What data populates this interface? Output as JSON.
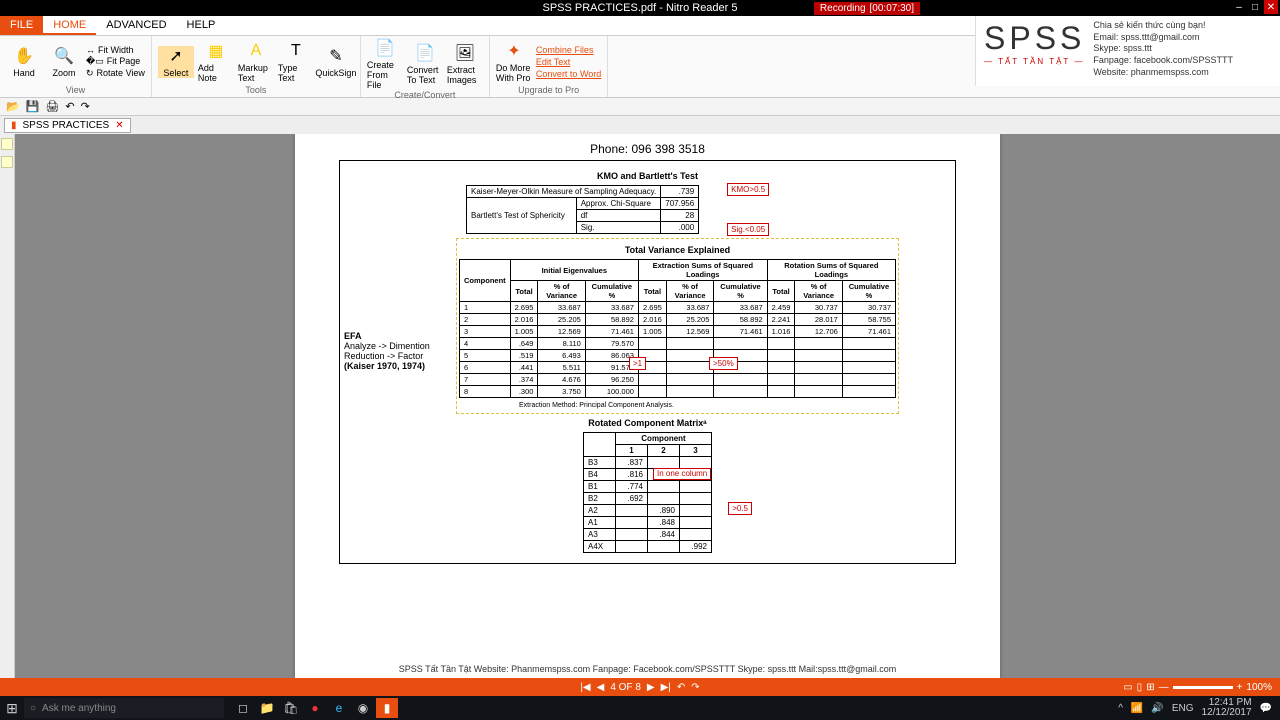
{
  "app": {
    "title": "SPSS PRACTICES.pdf - Nitro Reader 5"
  },
  "recording": {
    "label": "Recording",
    "time": "[00:07:30]"
  },
  "logo": {
    "main": "SPSS",
    "sub": "— TẤT TẦN TẬT —",
    "share": "Chia sẻ kiến thức cùng bạn!",
    "email": "Email: spss.ttt@gmail.com",
    "skype": "Skype: spss.ttt",
    "fanpage": "Fanpage: facebook.com/SPSSTTT",
    "website": "Website: phanmemspss.com"
  },
  "tabs": {
    "file": "FILE",
    "home": "HOME",
    "advanced": "ADVANCED",
    "help": "HELP"
  },
  "ribbon": {
    "view": {
      "hand": "Hand",
      "zoom": "Zoom",
      "fitwidth": "Fit Width",
      "fitpage": "Fit Page",
      "rotate": "Rotate View",
      "label": "View"
    },
    "tools": {
      "select": "Select",
      "addnote": "Add Note",
      "markup": "Markup Text",
      "typetext": "Type Text",
      "quicksign": "QuickSign",
      "label": "Tools"
    },
    "create": {
      "fromfile": "Create From File",
      "totext": "Convert To Text",
      "images": "Extract Images",
      "label": "Create/Convert"
    },
    "upgrade": {
      "domore": "Do More With Pro",
      "combine": "Combine Files",
      "edit": "Edit Text",
      "convert": "Convert to Word",
      "label": "Upgrade to Pro"
    }
  },
  "doctab": {
    "name": "SPSS PRACTICES"
  },
  "page": {
    "phone": "Phone: 096 398 3518",
    "side": {
      "efa": "EFA",
      "path": "Analyze -> Dimention Reduction -> Factor",
      "ref": "(Kaiser 1970, 1974)"
    },
    "kmo": {
      "title": "KMO and Bartlett's Test",
      "r1": "Kaiser-Meyer-Olkin Measure of Sampling Adequacy.",
      "v1": ".739",
      "r2": "Bartlett's Test of Sphericity",
      "r2a": "Approx. Chi-Square",
      "v2a": "707.956",
      "r2b": "df",
      "v2b": "28",
      "r2c": "Sig.",
      "v2c": ".000",
      "call1": "KMO>0.5",
      "call2": "Sig.<0.05"
    },
    "tve": {
      "title": "Total Variance Explained",
      "h_comp": "Component",
      "h_init": "Initial Eigenvalues",
      "h_ext": "Extraction Sums of Squared Loadings",
      "h_rot": "Rotation Sums of Squared Loadings",
      "sh_total": "Total",
      "sh_var": "% of Variance",
      "sh_cum": "Cumulative %",
      "rows": [
        {
          "c": "1",
          "t1": "2.695",
          "v1": "33.687",
          "c1": "33.687",
          "t2": "2.695",
          "v2": "33.687",
          "c2": "33.687",
          "t3": "2.459",
          "v3": "30.737",
          "c3": "30.737"
        },
        {
          "c": "2",
          "t1": "2.016",
          "v1": "25.205",
          "c1": "58.892",
          "t2": "2.016",
          "v2": "25.205",
          "c2": "58.892",
          "t3": "2.241",
          "v3": "28.017",
          "c3": "58.755"
        },
        {
          "c": "3",
          "t1": "1.005",
          "v1": "12.569",
          "c1": "71.461",
          "t2": "1.005",
          "v2": "12.569",
          "c2": "71.461",
          "t3": "1.016",
          "v3": "12.706",
          "c3": "71.461"
        },
        {
          "c": "4",
          "t1": ".649",
          "v1": "8.110",
          "c1": "79.570"
        },
        {
          "c": "5",
          "t1": ".519",
          "v1": "6.493",
          "c1": "86.063"
        },
        {
          "c": "6",
          "t1": ".441",
          "v1": "5.511",
          "c1": "91.574"
        },
        {
          "c": "7",
          "t1": ".374",
          "v1": "4.676",
          "c1": "96.250"
        },
        {
          "c": "8",
          "t1": ".300",
          "v1": "3.750",
          "c1": "100.000"
        }
      ],
      "foot": "Extraction Method: Principal Component Analysis.",
      "call_gt1": ">1",
      "call_gt50": ">50%"
    },
    "rcm": {
      "title": "Rotated Component Matrixᵃ",
      "h_comp": "Component",
      "rows": [
        {
          "v": "B3",
          "c1": ".837"
        },
        {
          "v": "B4",
          "c1": ".816"
        },
        {
          "v": "B1",
          "c1": ".774"
        },
        {
          "v": "B2",
          "c1": ".692"
        },
        {
          "v": "A2",
          "c2": ".890"
        },
        {
          "v": "A1",
          "c2": ".848"
        },
        {
          "v": "A3",
          "c2": ".844"
        },
        {
          "v": "A4X",
          "c3": ".992"
        }
      ],
      "call_one": "In one column",
      "call_gt05": ">0.5"
    },
    "footer": "SPSS Tất Tần Tật Website: Phanmemspss.com  Fanpage: Facebook.com/SPSSTTT  Skype: spss.ttt Mail:spss.ttt@gmail.com"
  },
  "status": {
    "page": "4 OF 8",
    "zoom": "100%"
  },
  "taskbar": {
    "search": "Ask me anything",
    "time": "12:41 PM",
    "date": "12/12/2017",
    "lang": "ENG"
  }
}
